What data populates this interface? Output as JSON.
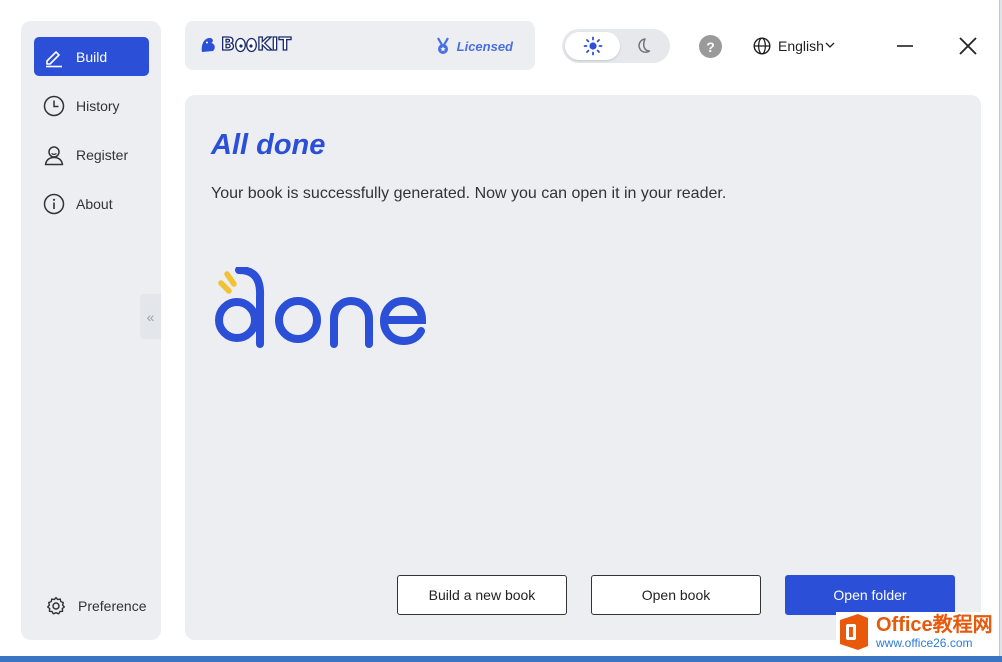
{
  "sidebar": {
    "items": [
      {
        "label": "Build",
        "icon": "pencil-icon",
        "active": true
      },
      {
        "label": "History",
        "icon": "clock-icon"
      },
      {
        "label": "Register",
        "icon": "user-icon"
      },
      {
        "label": "About",
        "icon": "info-icon"
      }
    ],
    "preference_label": "Preference",
    "collapse_glyph": "«"
  },
  "header": {
    "brand": "B",
    "brand_rest": "KIT",
    "license": "Licensed",
    "help": "?",
    "language": "English",
    "theme": "light"
  },
  "main": {
    "title": "All done",
    "subtitle": "Your book is successfully generated. Now you can open it in your reader.",
    "buttons": {
      "new_book": "Build a new book",
      "open_book": "Open book",
      "open_folder": "Open folder"
    }
  },
  "watermark": {
    "title": "Office教程网",
    "sub": "www.office26.com"
  },
  "colors": {
    "accent": "#2b4fd6",
    "sun_rays": "#f2c230",
    "panel": "#eceef2"
  }
}
